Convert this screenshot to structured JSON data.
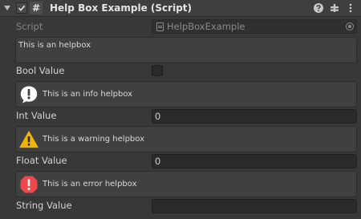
{
  "header": {
    "title": "Help Box Example (Script)",
    "script_icon_glyph": "#",
    "icons": [
      "help-icon",
      "preset-icon",
      "context-menu-icon"
    ]
  },
  "script_field": {
    "label": "Script",
    "value": "HelpBoxExample"
  },
  "helpboxes": {
    "plain": "This is an helpbox",
    "info": "This is an info helpbox",
    "warning": "This is a warning helpbox",
    "error": "This is an error helpbox"
  },
  "fields": {
    "bool_label": "Bool Value",
    "bool_value": false,
    "int_label": "Int Value",
    "int_value": "0",
    "float_label": "Float Value",
    "float_value": "0",
    "string_label": "String Value",
    "string_value": ""
  },
  "colors": {
    "background": "#383838",
    "info": "#ffffff",
    "warning": "#f0b500",
    "error": "#ec4a4a"
  }
}
